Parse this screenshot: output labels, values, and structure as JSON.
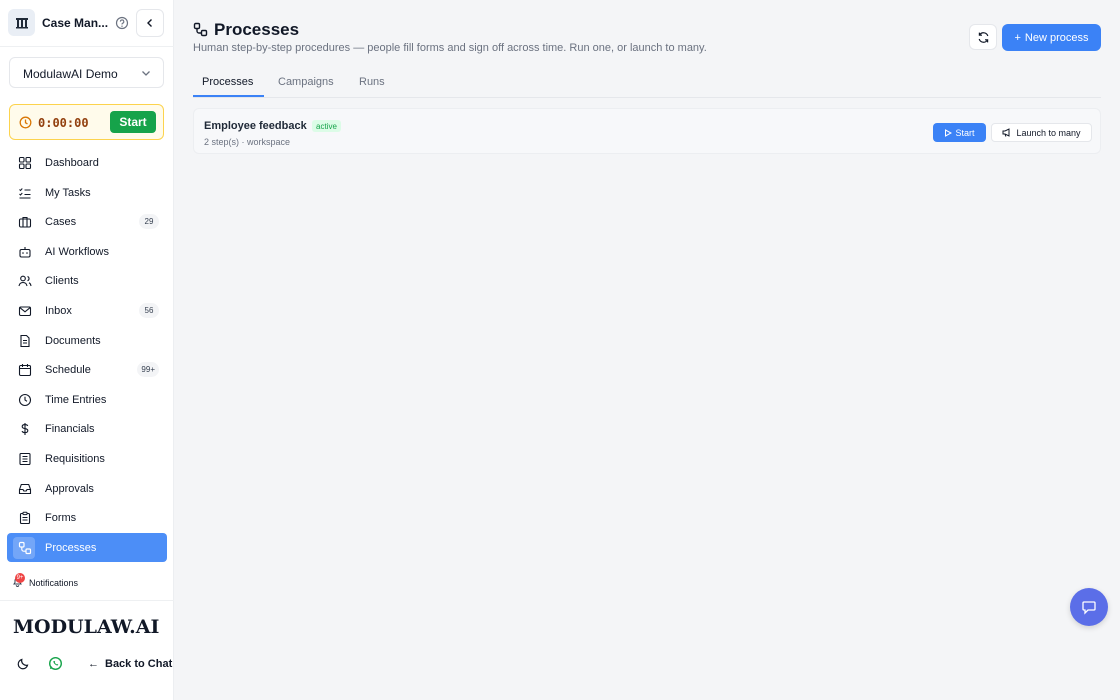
{
  "app": {
    "title": "Case Man..."
  },
  "workspace": {
    "selected": "ModulawAI Demo"
  },
  "timer": {
    "value": "0:00:00",
    "start_label": "Start"
  },
  "sidebar": {
    "items": [
      {
        "label": "Dashboard",
        "icon": "dashboard-icon",
        "badge": ""
      },
      {
        "label": "My Tasks",
        "icon": "tasks-icon",
        "badge": ""
      },
      {
        "label": "Cases",
        "icon": "briefcase-icon",
        "badge": "29"
      },
      {
        "label": "AI Workflows",
        "icon": "robot-icon",
        "badge": ""
      },
      {
        "label": "Clients",
        "icon": "users-icon",
        "badge": ""
      },
      {
        "label": "Inbox",
        "icon": "mail-icon",
        "badge": "56"
      },
      {
        "label": "Documents",
        "icon": "document-icon",
        "badge": ""
      },
      {
        "label": "Schedule",
        "icon": "calendar-icon",
        "badge": "99+"
      },
      {
        "label": "Time Entries",
        "icon": "clock-icon",
        "badge": ""
      },
      {
        "label": "Financials",
        "icon": "dollar-icon",
        "badge": ""
      },
      {
        "label": "Requisitions",
        "icon": "list-icon",
        "badge": ""
      },
      {
        "label": "Approvals",
        "icon": "inbox-icon",
        "badge": ""
      },
      {
        "label": "Forms",
        "icon": "clipboard-icon",
        "badge": ""
      },
      {
        "label": "Processes",
        "icon": "workflow-icon",
        "badge": "",
        "active": true
      }
    ],
    "notifications": {
      "label": "Notifications",
      "count": "9+"
    },
    "wordmark": "MODULAW.AI",
    "back_label": "Back to Chat"
  },
  "page": {
    "title": "Processes",
    "subtitle": "Human step-by-step procedures — people fill forms and sign off across time. Run one, or launch to many.",
    "new_button": "New process",
    "tabs": [
      {
        "label": "Processes",
        "active": true
      },
      {
        "label": "Campaigns",
        "active": false
      },
      {
        "label": "Runs",
        "active": false
      }
    ]
  },
  "processes": [
    {
      "name": "Employee feedback",
      "status": "active",
      "meta": "2 step(s) · workspace",
      "start_label": "Start",
      "launch_label": "Launch to many"
    }
  ],
  "colors": {
    "accent": "#3b82f6",
    "sidebar_active": "#4c8ef7",
    "timer_start": "#16a34a",
    "status_active": "#16a34a",
    "chat_fab": "#5b6ee8"
  }
}
